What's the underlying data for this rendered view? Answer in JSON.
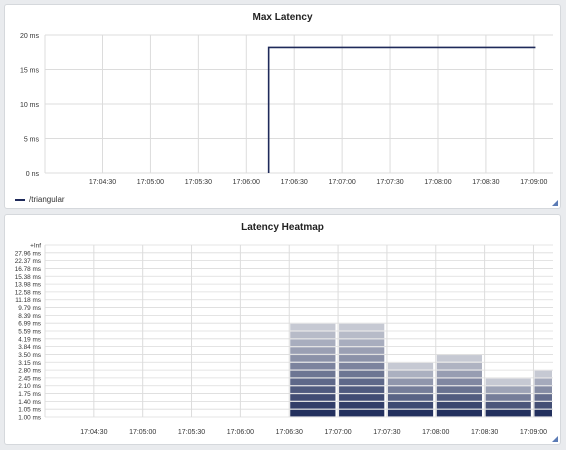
{
  "panels": {
    "max_latency": {
      "title": "Max Latency",
      "legend_label": "/triangular",
      "line_color": "#1f2a5a",
      "resize_icon": "corner-resize-icon"
    },
    "heatmap": {
      "title": "Latency Heatmap",
      "resize_icon": "corner-resize-icon"
    }
  },
  "chart_data": [
    {
      "type": "line",
      "title": "Max Latency",
      "xlabel": "",
      "ylabel": "",
      "y_ticks": [
        "20 ms",
        "15 ms",
        "10 ms",
        "5 ms",
        "0 ns"
      ],
      "y_tick_values": [
        20,
        15,
        10,
        5,
        0
      ],
      "ylim": [
        0,
        20
      ],
      "x_ticks": [
        "17:04:30",
        "17:05:00",
        "17:05:30",
        "17:06:00",
        "17:06:30",
        "17:07:00",
        "17:07:30",
        "17:08:00",
        "17:08:30",
        "17:09:00"
      ],
      "xlim": [
        "17:03:54",
        "17:09:12"
      ],
      "grid": true,
      "legend": "bottom-left",
      "series": [
        {
          "name": "/triangular",
          "x": [
            "17:06:14",
            "17:06:14",
            "17:09:01"
          ],
          "y": [
            0,
            18.2,
            18.2
          ]
        }
      ]
    },
    {
      "type": "heatmap",
      "title": "Latency Heatmap",
      "y_buckets": [
        "1.00 ms",
        "1.05 ms",
        "1.40 ms",
        "1.75 ms",
        "2.10 ms",
        "2.45 ms",
        "2.80 ms",
        "3.15 ms",
        "3.50 ms",
        "3.84 ms",
        "4.19 ms",
        "5.59 ms",
        "6.99 ms",
        "8.39 ms",
        "9.79 ms",
        "11.18 ms",
        "12.58 ms",
        "13.98 ms",
        "15.38 ms",
        "16.78 ms",
        "22.37 ms",
        "27.96 ms",
        "+Inf"
      ],
      "x_ticks": [
        "17:04:30",
        "17:05:00",
        "17:05:30",
        "17:06:00",
        "17:06:30",
        "17:07:00",
        "17:07:30",
        "17:08:00",
        "17:08:30",
        "17:09:00"
      ],
      "xlim": [
        "17:04:00",
        "17:09:12"
      ],
      "grid": true,
      "columns": [
        {
          "start": "17:06:30",
          "end": "17:06:59",
          "top_bucket": 12
        },
        {
          "start": "17:07:00",
          "end": "17:07:29",
          "top_bucket": 12
        },
        {
          "start": "17:07:30",
          "end": "17:07:59",
          "top_bucket": 7
        },
        {
          "start": "17:08:00",
          "end": "17:08:29",
          "top_bucket": 8
        },
        {
          "start": "17:08:30",
          "end": "17:08:59",
          "top_bucket": 5
        },
        {
          "start": "17:09:00",
          "end": "17:09:12",
          "top_bucket": 6
        }
      ],
      "color_low": "#23305e",
      "color_high": "#c6c9d3"
    }
  ]
}
